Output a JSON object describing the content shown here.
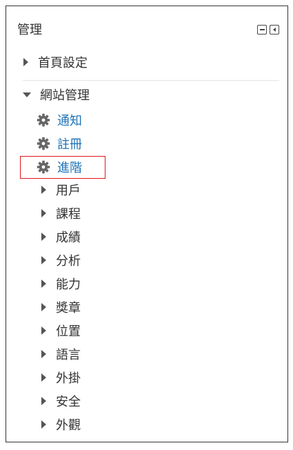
{
  "panel": {
    "title": "管理",
    "controls": [
      "minus-icon",
      "collapse-left-icon"
    ]
  },
  "home_settings": {
    "label": "首頁設定",
    "icon": "caret-right-icon"
  },
  "site_admin": {
    "label": "網站管理",
    "icon": "caret-down-icon",
    "gear_items": [
      {
        "label": "通知",
        "icon": "gear-icon"
      },
      {
        "label": "註冊",
        "icon": "gear-icon"
      },
      {
        "label": "進階",
        "icon": "gear-icon"
      }
    ],
    "sub_items": [
      {
        "label": "用戶",
        "icon": "caret-right-icon"
      },
      {
        "label": "課程",
        "icon": "caret-right-icon"
      },
      {
        "label": "成績",
        "icon": "caret-right-icon"
      },
      {
        "label": "分析",
        "icon": "caret-right-icon"
      },
      {
        "label": "能力",
        "icon": "caret-right-icon"
      },
      {
        "label": "獎章",
        "icon": "caret-right-icon"
      },
      {
        "label": "位置",
        "icon": "caret-right-icon"
      },
      {
        "label": "語言",
        "icon": "caret-right-icon"
      },
      {
        "label": "外掛",
        "icon": "caret-right-icon"
      },
      {
        "label": "安全",
        "icon": "caret-right-icon"
      },
      {
        "label": "外觀",
        "icon": "caret-right-icon"
      }
    ]
  },
  "colors": {
    "link": "#1e73b8",
    "highlight_border": "#e0161a",
    "gear": "#666666"
  }
}
